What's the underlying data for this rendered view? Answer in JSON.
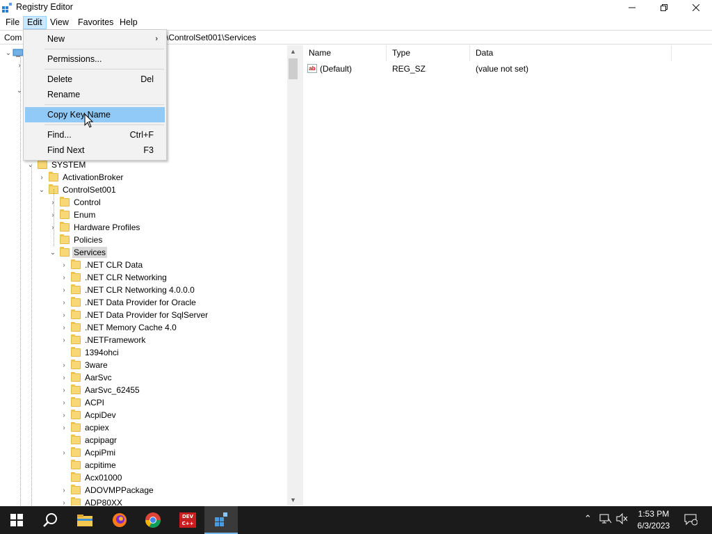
{
  "window": {
    "title": "Registry Editor"
  },
  "menubar": [
    "File",
    "Edit",
    "View",
    "Favorites",
    "Help"
  ],
  "address": {
    "prefix": "Com",
    "path_suffix": "\\ControlSet001\\Services"
  },
  "edit_menu": {
    "new": "New",
    "permissions": "Permissions...",
    "delete": "Delete",
    "delete_shortcut": "Del",
    "rename": "Rename",
    "copy_key_name": "Copy Key Name",
    "find": "Find...",
    "find_shortcut": "Ctrl+F",
    "find_next": "Find Next",
    "find_next_shortcut": "F3"
  },
  "tree": {
    "system": "SYSTEM",
    "activation_broker": "ActivationBroker",
    "controlset001": "ControlSet001",
    "control": "Control",
    "enum": "Enum",
    "hardware_profiles": "Hardware Profiles",
    "policies": "Policies",
    "services": "Services",
    "services_children": [
      ".NET CLR Data",
      ".NET CLR Networking",
      ".NET CLR Networking 4.0.0.0",
      ".NET Data Provider for Oracle",
      ".NET Data Provider for SqlServer",
      ".NET Memory Cache 4.0",
      ".NETFramework",
      "1394ohci",
      "3ware",
      "AarSvc",
      "AarSvc_62455",
      "ACPI",
      "AcpiDev",
      "acpiex",
      "acpipagr",
      "AcpiPmi",
      "acpitime",
      "Acx01000",
      "ADOVMPPackage",
      "ADP80XX"
    ]
  },
  "values": {
    "columns": {
      "name": "Name",
      "type": "Type",
      "data": "Data"
    },
    "rows": [
      {
        "name": "(Default)",
        "type": "REG_SZ",
        "data": "(value not set)"
      }
    ]
  },
  "taskbar": {
    "time": "1:53 PM",
    "date": "6/3/2023",
    "dev_label": "DEV C++"
  },
  "colors": {
    "menu_highlight": "#91c9f7",
    "menu_active": "#cce8ff",
    "taskbar": "#1b1b1b",
    "folder": "#f8d775"
  }
}
